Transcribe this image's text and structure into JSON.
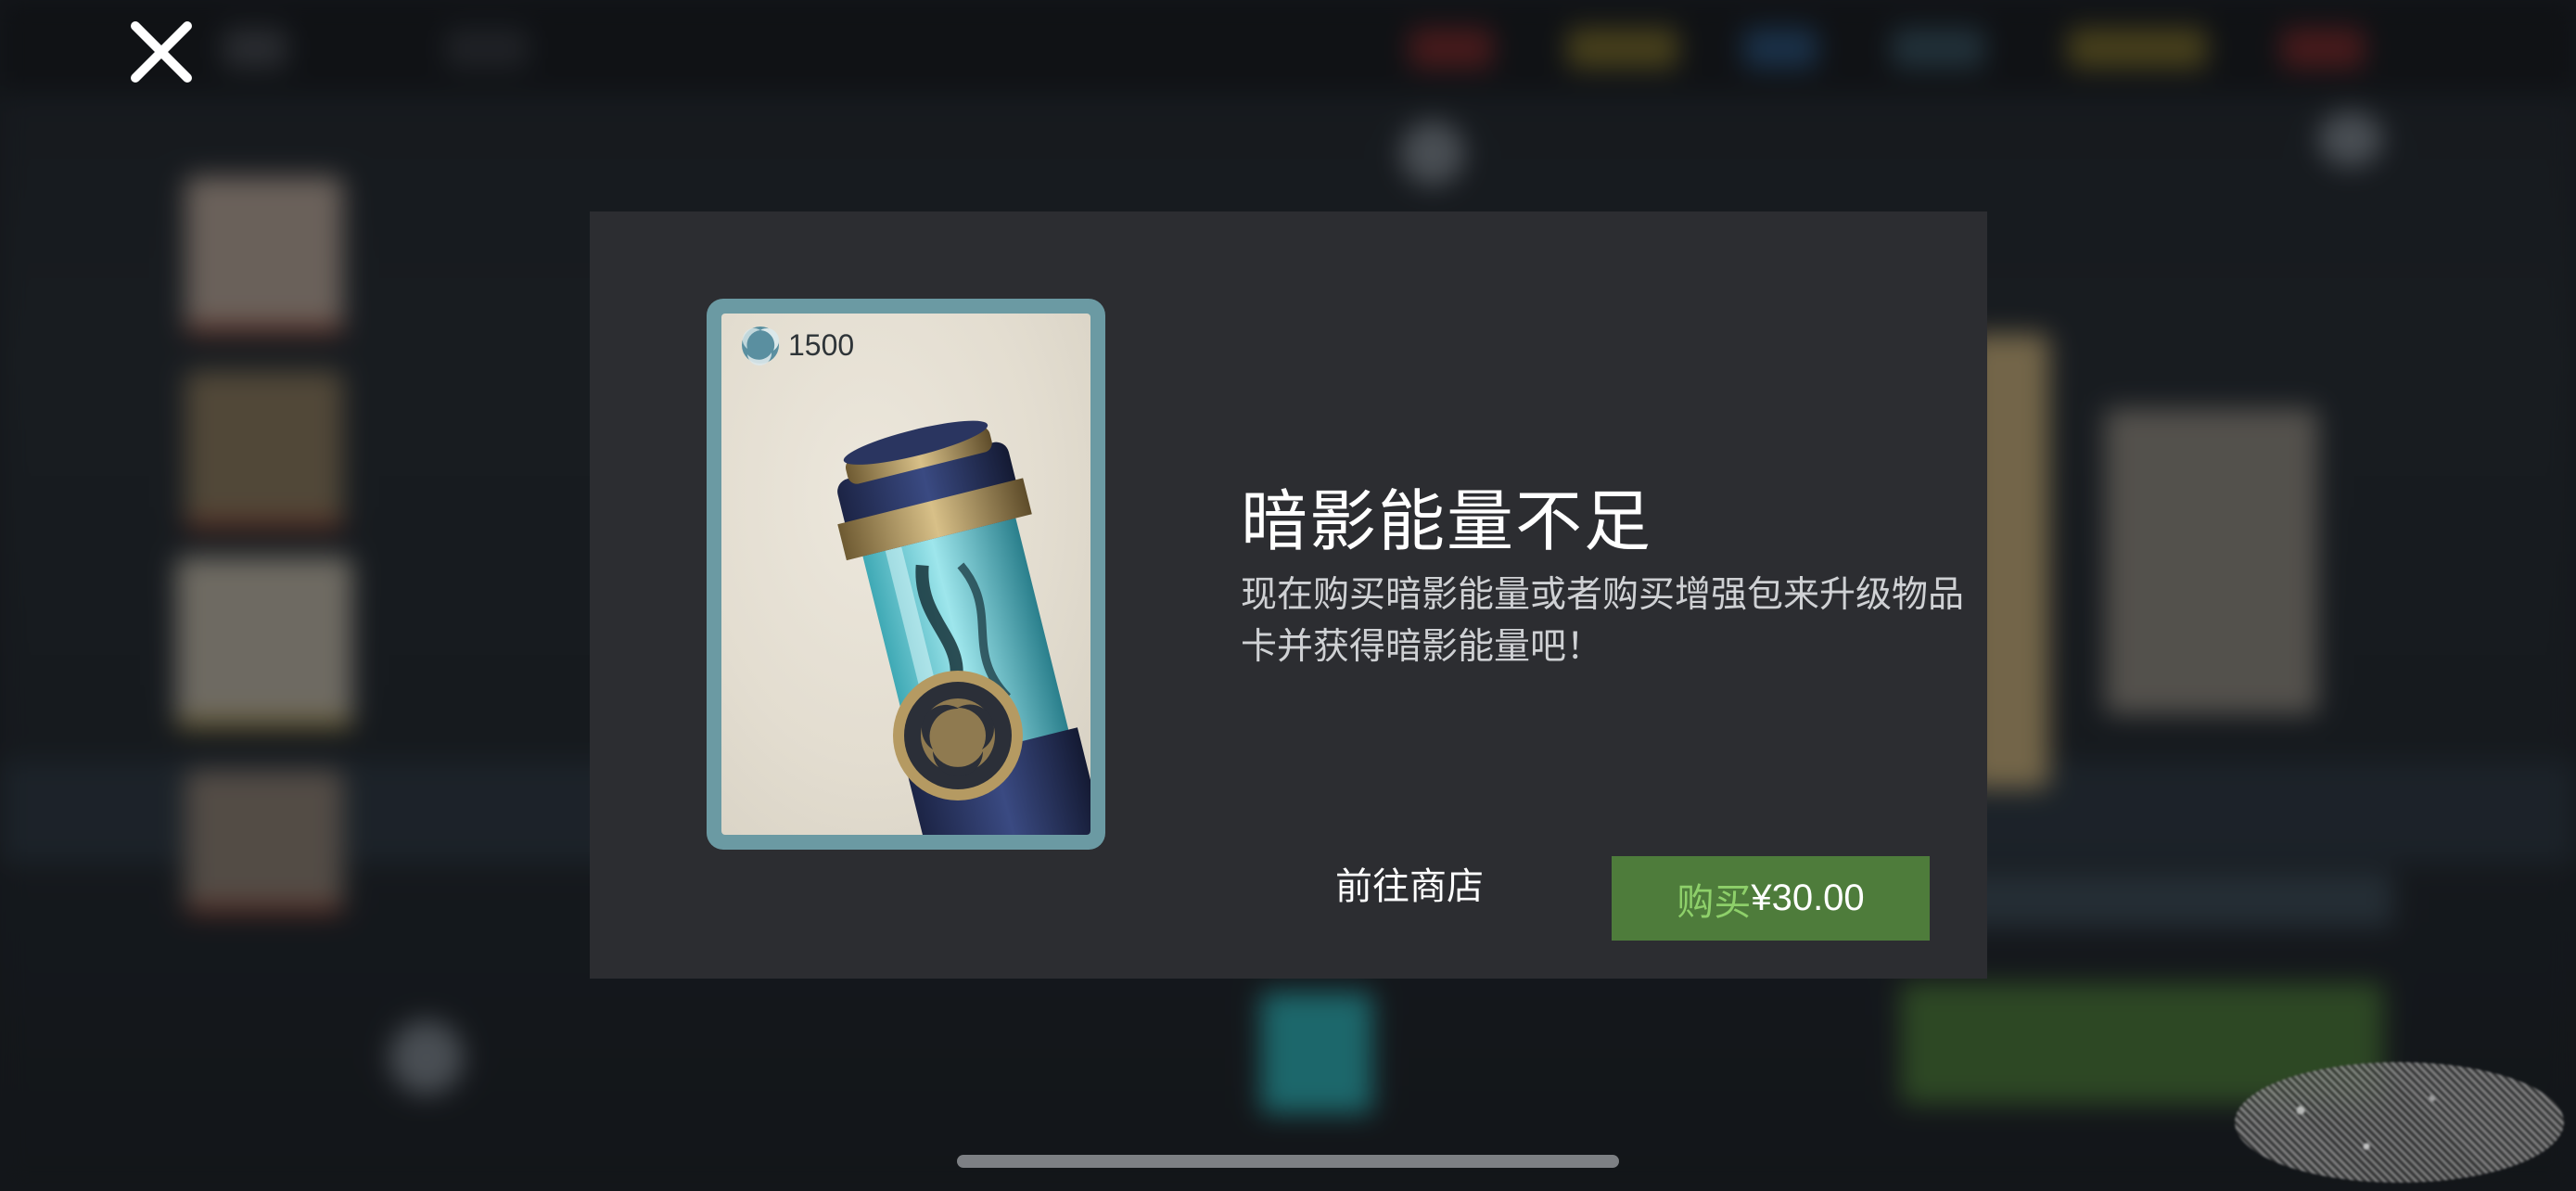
{
  "dialog": {
    "title": "暗影能量不足",
    "message": "现在购买暗影能量或者购买增强包来升级物品卡并获得暗影能量吧！",
    "store_label": "前往商店",
    "buy_label": "购买",
    "buy_price": "¥30.00"
  },
  "card": {
    "cost": "1500",
    "cost_icon": "shadow-energy-icon",
    "art": "shadow-energy-canister"
  },
  "icons": {
    "close": "close-icon"
  },
  "colors": {
    "dialog_bg": "#2c2d31",
    "buy_button": "#4e7c3b",
    "buy_label": "#8ed06a",
    "card_frame": "#6b9aa3"
  }
}
